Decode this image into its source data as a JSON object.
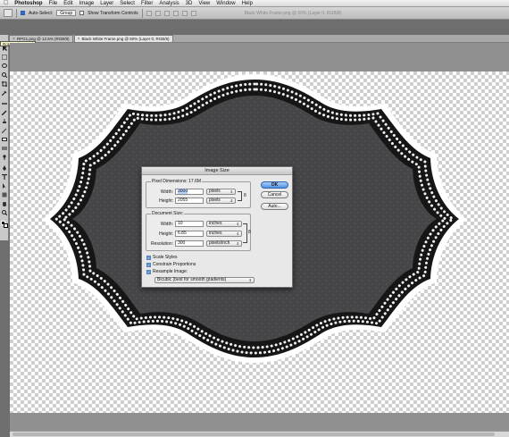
{
  "menubar": {
    "app_name": "Photoshop",
    "items": [
      "File",
      "Edit",
      "Image",
      "Layer",
      "Select",
      "Filter",
      "Analysis",
      "3D",
      "View",
      "Window",
      "Help"
    ]
  },
  "options_bar": {
    "auto_select_label": "Auto-Select:",
    "auto_select_value": "Group",
    "transform_label": "Show Transform Controls",
    "ghost_window_title": "Black White Frame.png @ 50% (Layer 0, RGB/8)"
  },
  "tabs": [
    {
      "label": "RPG1.png @ 12.5% (RGB/8)"
    },
    {
      "label": "Black White Frame.png @ 50% (Layer 0, RGB/8)"
    }
  ],
  "tooltip": "Rotate View Tool",
  "dialog": {
    "title": "Image Size",
    "pixel_dimensions_label": "Pixel Dimensions:",
    "pixel_dimensions_value": "17.6M",
    "width_label": "Width:",
    "height_label": "Height:",
    "px_width": "3000",
    "px_height": "2055",
    "px_unit": "pixels",
    "document_size_label": "Document Size:",
    "doc_width": "10",
    "doc_height": "6.85",
    "doc_unit": "inches",
    "resolution_label": "Resolution:",
    "resolution": "300",
    "resolution_unit": "pixels/inch",
    "ok_label": "OK",
    "cancel_label": "Cancel",
    "auto_label": "Auto...",
    "scale_styles_label": "Scale Styles",
    "constrain_label": "Constrain Proportions",
    "resample_label": "Resample Image:",
    "resample_method": "Bicubic (best for smooth gradients)"
  }
}
